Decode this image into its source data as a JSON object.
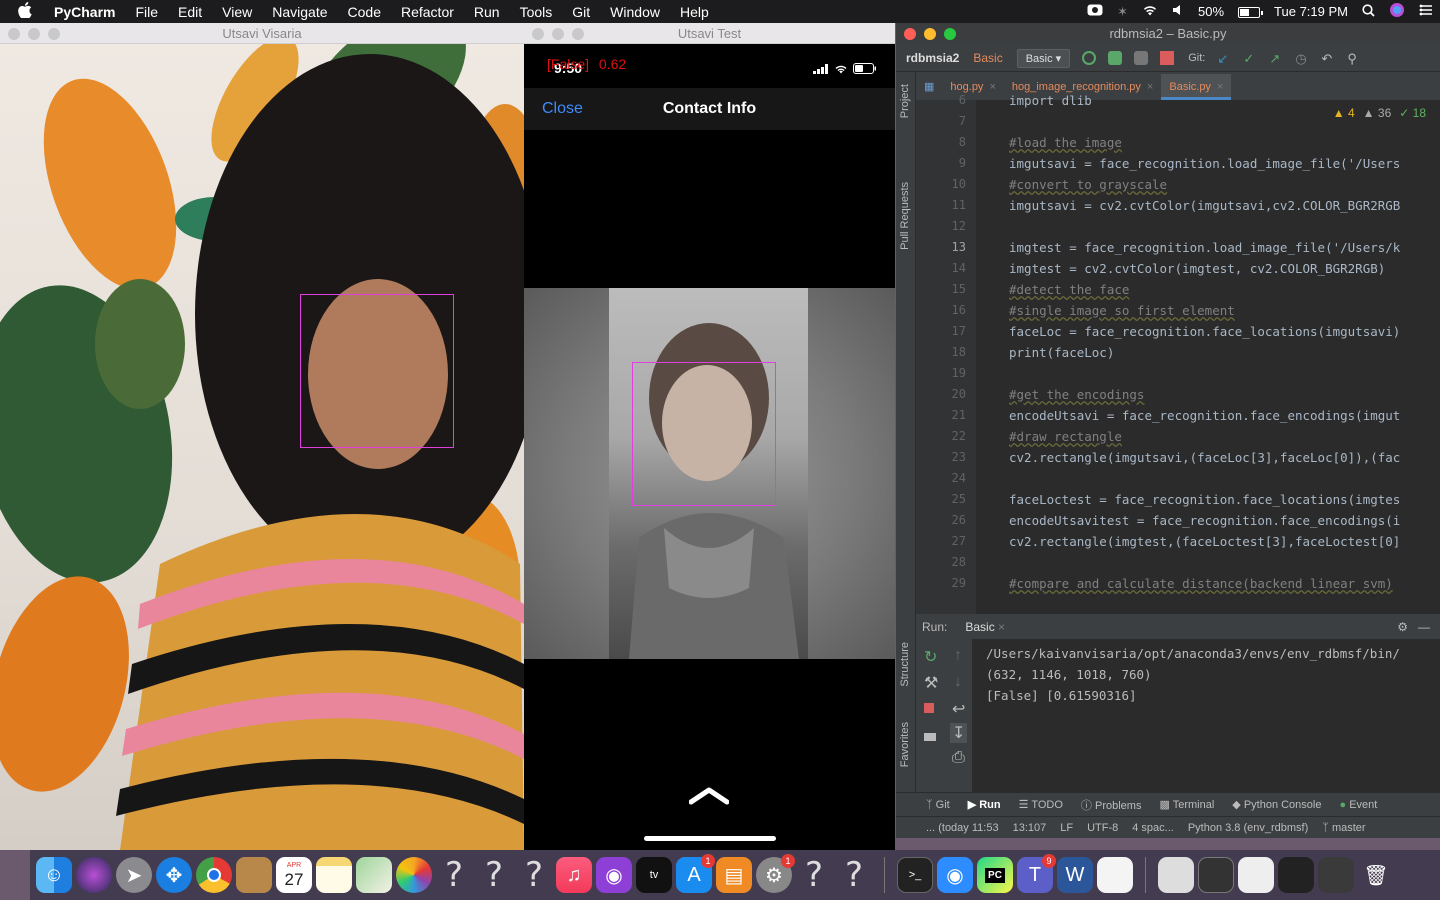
{
  "menubar": {
    "app_name": "PyCharm",
    "menus": [
      "File",
      "Edit",
      "View",
      "Navigate",
      "Code",
      "Refactor",
      "Run",
      "Tools",
      "Git",
      "Window",
      "Help"
    ],
    "battery": "50%",
    "clock": "Tue 7:19 PM"
  },
  "win1": {
    "title": "Utsavi Visaria"
  },
  "win2": {
    "title": "Utsavi Test",
    "overlay_label": "[False]",
    "overlay_distance": "0.62",
    "phone_time": "9:50",
    "close_label": "Close",
    "header_title": "Contact Info"
  },
  "pycharm": {
    "title": "rdbmsia2 – Basic.py",
    "project": "rdbmsia2",
    "crumb": "Basic",
    "run_config": "Basic",
    "git_label": "Git:",
    "side_tabs": {
      "project": "Project",
      "pull_requests": "Pull Requests",
      "structure": "Structure",
      "favorites": "Favorites"
    },
    "tabs": [
      {
        "label": "hog.py"
      },
      {
        "label": "hog_image_recognition.py"
      },
      {
        "label": "Basic.py"
      }
    ],
    "inspections": {
      "warn_a": "4",
      "warn_b": "36",
      "ok": "18"
    },
    "editor_lines": [
      {
        "n": "6",
        "code": "import dlib"
      },
      {
        "n": "7",
        "code": ""
      },
      {
        "n": "8",
        "code": "#load the image"
      },
      {
        "n": "9",
        "code": "imgutsavi = face_recognition.load_image_file('/Users"
      },
      {
        "n": "10",
        "code": "#convert to grayscale"
      },
      {
        "n": "11",
        "code": "imgutsavi = cv2.cvtColor(imgutsavi,cv2.COLOR_BGR2RGB"
      },
      {
        "n": "12",
        "code": ""
      },
      {
        "n": "13",
        "code": "imgtest = face_recognition.load_image_file('/Users/k"
      },
      {
        "n": "14",
        "code": "imgtest = cv2.cvtColor(imgtest, cv2.COLOR_BGR2RGB)"
      },
      {
        "n": "15",
        "code": "#detect the face"
      },
      {
        "n": "16",
        "code": "#single image so first element"
      },
      {
        "n": "17",
        "code": "faceLoc = face_recognition.face_locations(imgutsavi)"
      },
      {
        "n": "18",
        "code": "print(faceLoc)"
      },
      {
        "n": "19",
        "code": ""
      },
      {
        "n": "20",
        "code": "#get the encodings"
      },
      {
        "n": "21",
        "code": "encodeUtsavi = face_recognition.face_encodings(imgut"
      },
      {
        "n": "22",
        "code": "#draw rectangle"
      },
      {
        "n": "23",
        "code": "cv2.rectangle(imgutsavi,(faceLoc[3],faceLoc[0]),(fac"
      },
      {
        "n": "24",
        "code": ""
      },
      {
        "n": "25",
        "code": "faceLoctest = face_recognition.face_locations(imgtes"
      },
      {
        "n": "26",
        "code": "encodeUtsavitest = face_recognition.face_encodings(i"
      },
      {
        "n": "27",
        "code": "cv2.rectangle(imgtest,(faceLoctest[3],faceLoctest[0]"
      },
      {
        "n": "28",
        "code": ""
      },
      {
        "n": "29",
        "code": "#compare and calculate distance(backend linear svm)"
      }
    ],
    "run": {
      "label": "Run:",
      "tab": "Basic",
      "output": [
        "/Users/kaivanvisaria/opt/anaconda3/envs/env_rdbmsf/bin/",
        "(632, 1146, 1018, 760)",
        "[False] [0.61590316]"
      ]
    },
    "bottom_tools": [
      "Git",
      "Run",
      "TODO",
      "Problems",
      "Terminal",
      "Python Console",
      "Event"
    ],
    "status": {
      "vcs": "... (today 11:53",
      "pos": "13:107",
      "lf": "LF",
      "enc": "UTF-8",
      "indent": "4 spac...",
      "interp": "Python 3.8 (env_rdbmsf)",
      "branch": "master"
    }
  },
  "dock": {
    "calendar_month": "APR",
    "calendar_day": "27",
    "appstore_badge": "1",
    "settings_badge": "1",
    "teams_badge": "9",
    "teams_letter": "T",
    "word_letter": "W",
    "pycharm_letters": "PC"
  }
}
